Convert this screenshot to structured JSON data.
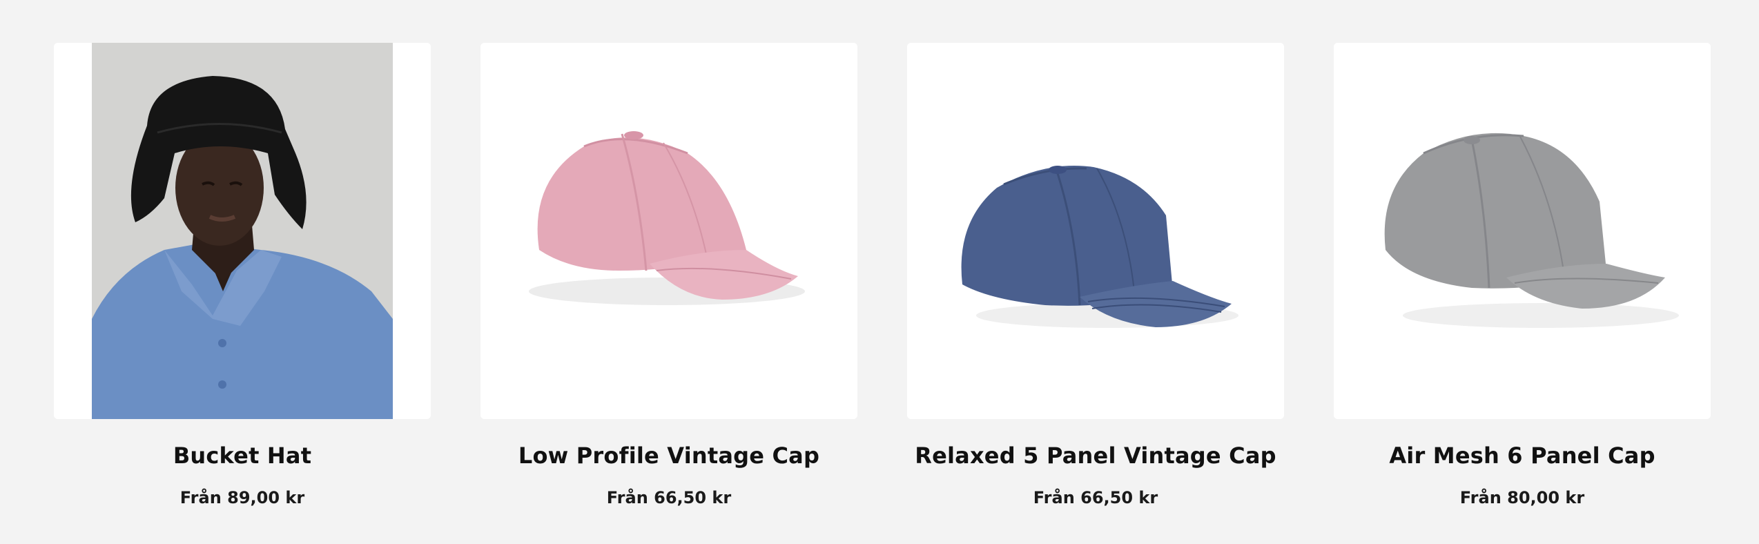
{
  "products": [
    {
      "name": "Bucket Hat",
      "price": "Från 89,00 kr",
      "image": "bucket-hat-on-model-photo",
      "colors": {
        "hat": "#151515",
        "shirt": "#6b8fc4",
        "backdrop": "#d4d4d2"
      }
    },
    {
      "name": "Low Profile Vintage Cap",
      "price": "Från 66,50 kr",
      "image": "pink-cap-photo",
      "colors": {
        "cap": "#e4a9b8"
      }
    },
    {
      "name": "Relaxed 5 Panel Vintage Cap",
      "price": "Från 66,50 kr",
      "image": "navy-cap-photo",
      "colors": {
        "cap": "#4a5f8e"
      }
    },
    {
      "name": "Air Mesh 6 Panel Cap",
      "price": "Från 80,00 kr",
      "image": "grey-cap-photo",
      "colors": {
        "cap": "#9a9b9d"
      }
    }
  ]
}
